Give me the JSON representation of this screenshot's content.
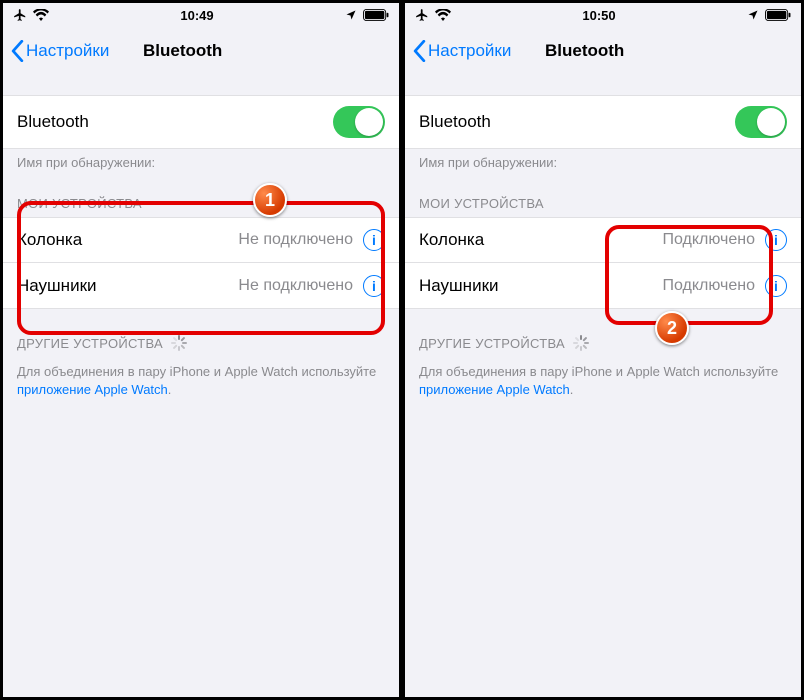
{
  "screens": [
    {
      "statusbar": {
        "time": "10:49"
      },
      "nav": {
        "back": "Настройки",
        "title": "Bluetooth"
      },
      "bluetooth_row": {
        "label": "Bluetooth",
        "on": true
      },
      "discover_label": "Имя при обнаружении:",
      "my_devices_header": "МОИ УСТРОЙСТВА",
      "devices": [
        {
          "name": "Колонка",
          "status": "Не подключено"
        },
        {
          "name": "Наушники",
          "status": "Не подключено"
        }
      ],
      "other_header": "ДРУГИЕ УСТРОЙСТВА",
      "footer_pre": "Для объединения в пару iPhone и Apple Watch используйте ",
      "footer_link": "приложение Apple Watch",
      "callout_number": "1"
    },
    {
      "statusbar": {
        "time": "10:50"
      },
      "nav": {
        "back": "Настройки",
        "title": "Bluetooth"
      },
      "bluetooth_row": {
        "label": "Bluetooth",
        "on": true
      },
      "discover_label": "Имя при обнаружении:",
      "my_devices_header": "МОИ УСТРОЙСТВА",
      "devices": [
        {
          "name": "Колонка",
          "status": "Подключено"
        },
        {
          "name": "Наушники",
          "status": "Подключено"
        }
      ],
      "other_header": "ДРУГИЕ УСТРОЙСТВА",
      "footer_pre": "Для объединения в пару iPhone и Apple Watch используйте ",
      "footer_link": "приложение Apple Watch",
      "callout_number": "2"
    }
  ]
}
